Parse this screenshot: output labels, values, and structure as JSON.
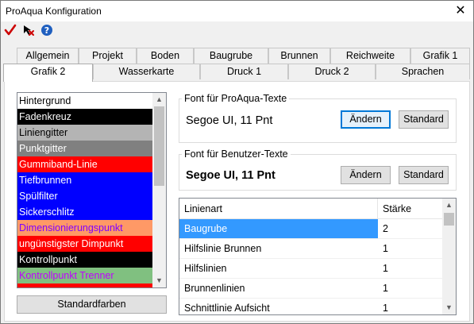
{
  "window": {
    "title": "ProAqua Konfiguration",
    "close_glyph": "✕"
  },
  "toolbar": {
    "icons": [
      "checkmark-icon",
      "cursor-icon",
      "help-icon"
    ],
    "colors": {
      "check": "#cc0000",
      "help": "#1f5fbf"
    }
  },
  "tabs": {
    "row_back": [
      "Allgemein",
      "Projekt",
      "Boden",
      "Baugrube",
      "Brunnen",
      "Reichweite",
      "Grafik 1"
    ],
    "row_front": [
      "Grafik 2",
      "Wasserkarte",
      "Druck 1",
      "Druck 2",
      "Sprachen"
    ],
    "active": "Grafik 2"
  },
  "color_list": {
    "items": [
      {
        "label": "Hintergrund",
        "bg": "#ffffff",
        "fg": "#000000"
      },
      {
        "label": "Fadenkreuz",
        "bg": "#000000",
        "fg": "#ffffff"
      },
      {
        "label": "Liniengitter",
        "bg": "#b4b4b4",
        "fg": "#000000"
      },
      {
        "label": "Punktgitter",
        "bg": "#808080",
        "fg": "#ffffff"
      },
      {
        "label": "Gummiband-Linie",
        "bg": "#ff0000",
        "fg": "#ffffff"
      },
      {
        "label": "Tiefbrunnen",
        "bg": "#0000ff",
        "fg": "#ffffff"
      },
      {
        "label": "Spülfilter",
        "bg": "#0000ff",
        "fg": "#ffffff"
      },
      {
        "label": "Sickerschlitz",
        "bg": "#0000ff",
        "fg": "#ffffff"
      },
      {
        "label": "Dimensionierungspunkt",
        "bg": "#ff9966",
        "fg": "#8000ff"
      },
      {
        "label": "ungünstigster Dimpunkt",
        "bg": "#ff0000",
        "fg": "#ffffff"
      },
      {
        "label": "Kontrollpunkt",
        "bg": "#000000",
        "fg": "#ffffff"
      },
      {
        "label": "Kontrollpunkt Trenner",
        "bg": "#80c080",
        "fg": "#c000ff"
      },
      {
        "label": "",
        "bg": "#ff0000",
        "fg": "#ffffff"
      }
    ],
    "default_button": "Standardfarben"
  },
  "font_proaqua": {
    "group_label": "Font für ProAqua-Texte",
    "sample": "Segoe UI, 11 Pnt",
    "change_button": "Ändern",
    "default_button": "Standard"
  },
  "font_user": {
    "group_label": "Font für Benutzer-Texte",
    "sample": "Segoe UI, 11 Pnt",
    "change_button": "Ändern",
    "default_button": "Standard"
  },
  "line_table": {
    "headers": [
      "Linienart",
      "Stärke"
    ],
    "rows": [
      {
        "name": "Baugrube",
        "width": "2",
        "selected": true
      },
      {
        "name": "Hilfslinie Brunnen",
        "width": "1",
        "selected": false
      },
      {
        "name": "Hilfslinien",
        "width": "1",
        "selected": false
      },
      {
        "name": "Brunnenlinien",
        "width": "1",
        "selected": false
      },
      {
        "name": "Schnittlinie Aufsicht",
        "width": "1",
        "selected": false
      }
    ]
  }
}
